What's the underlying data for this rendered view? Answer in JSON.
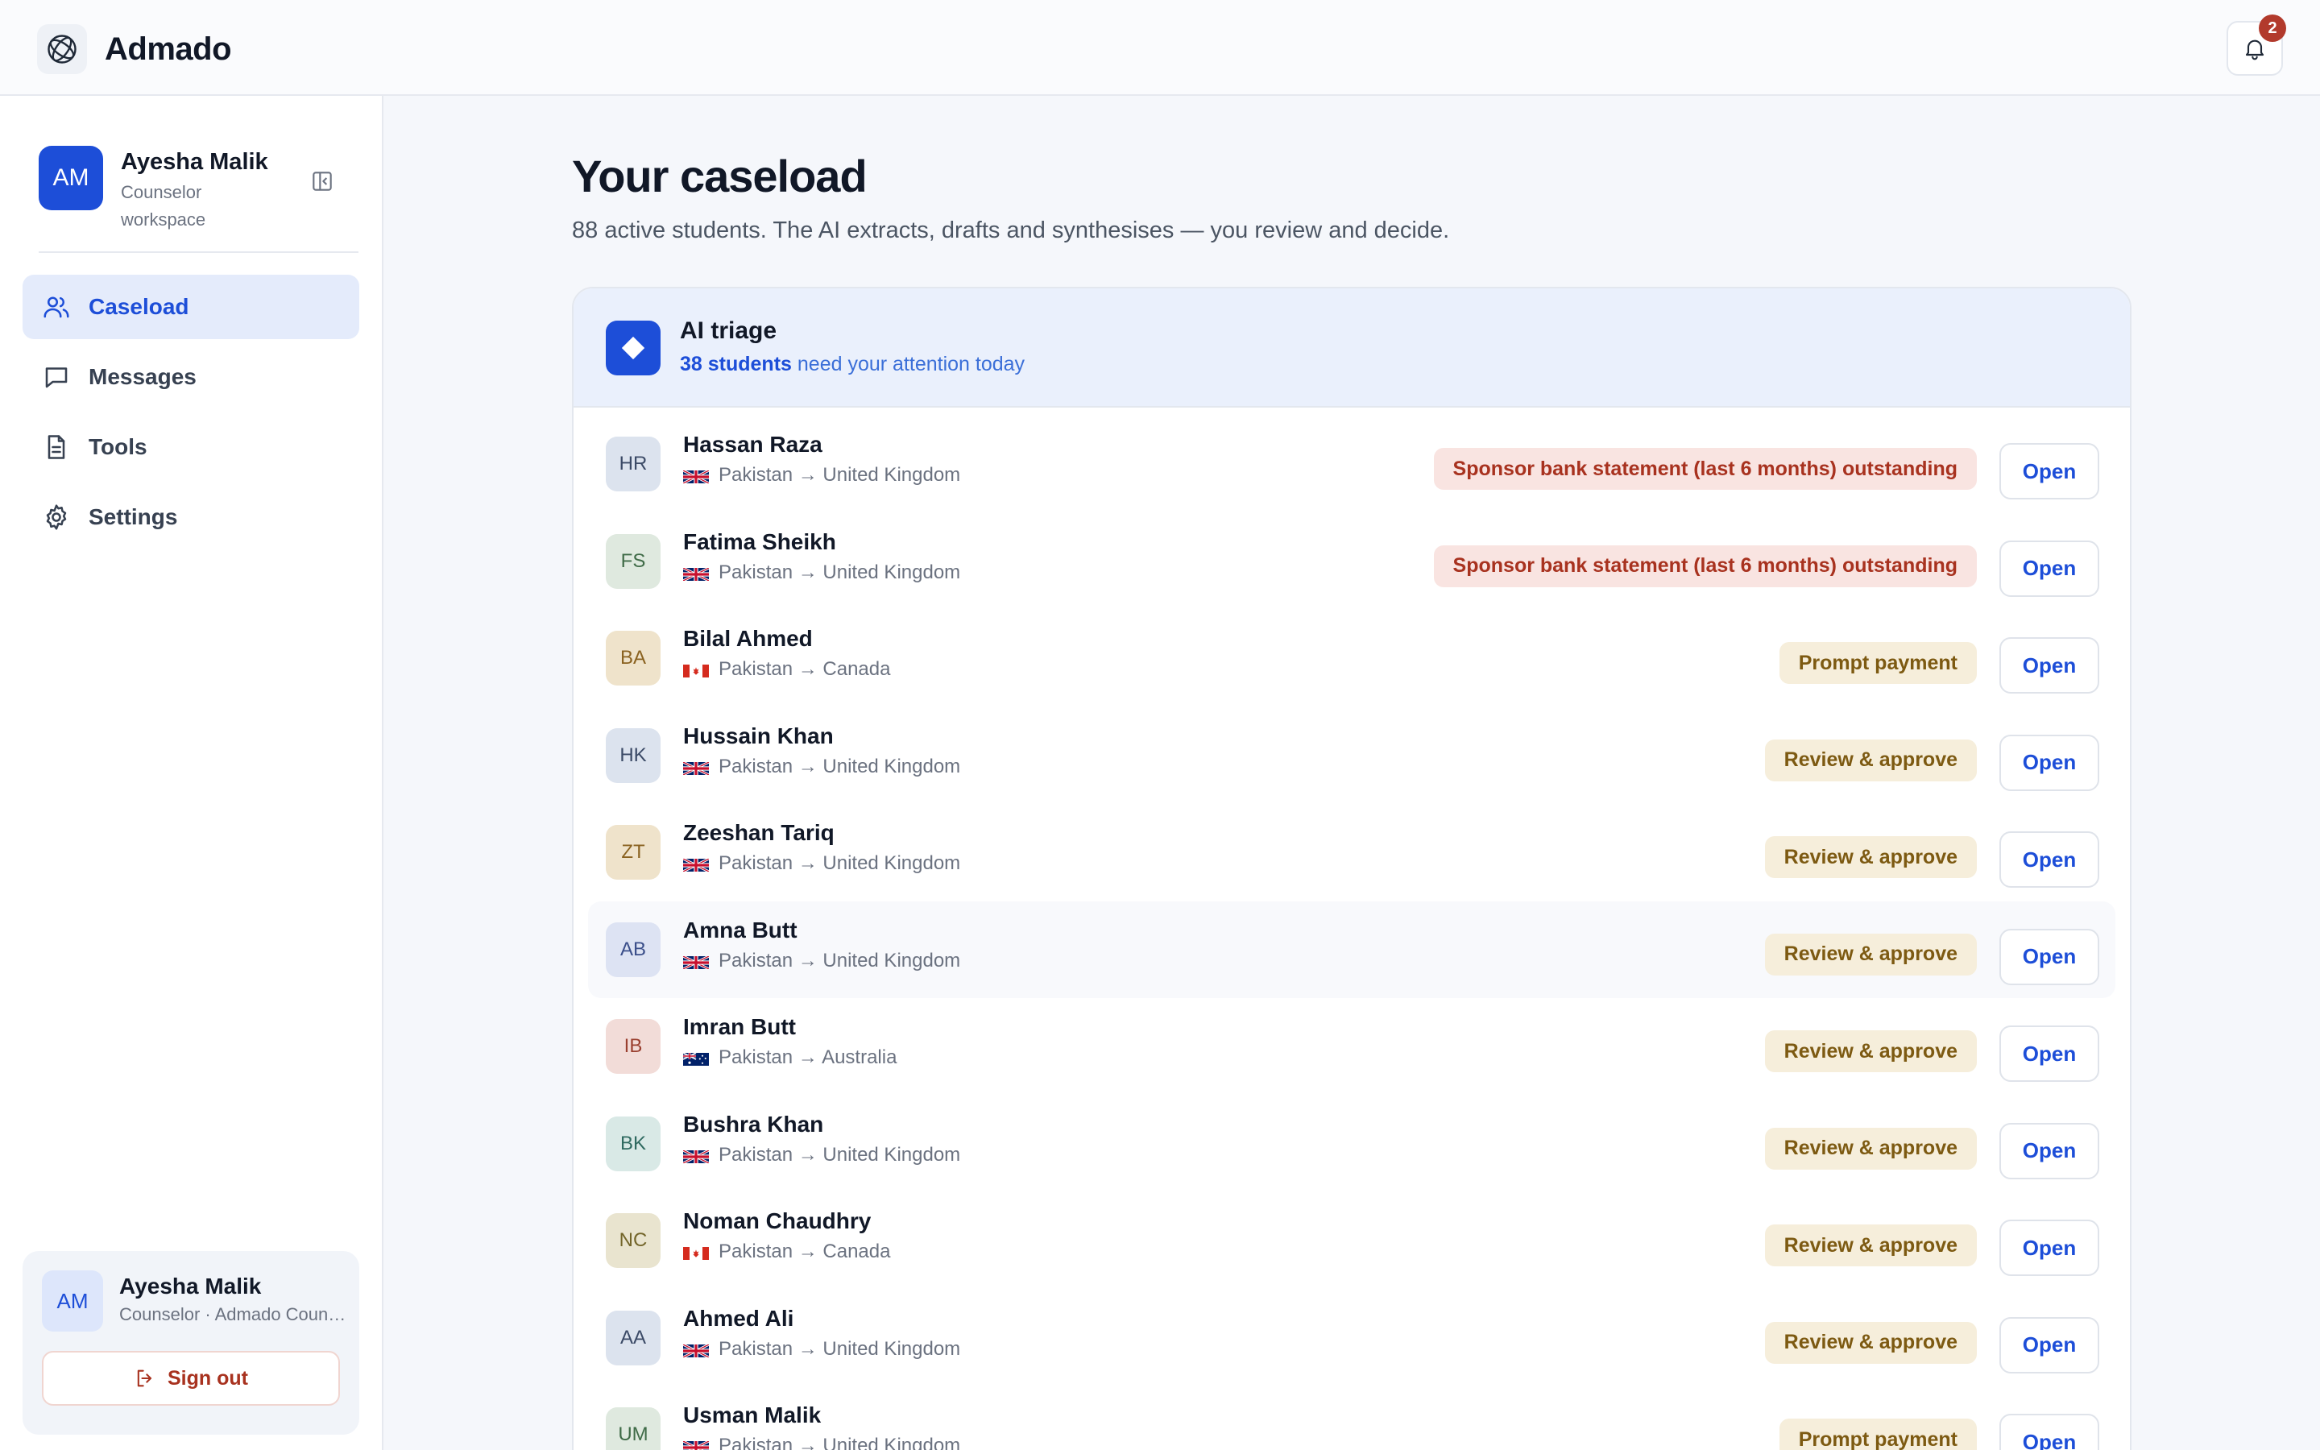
{
  "app": {
    "name": "Admado"
  },
  "notifications": {
    "count": "2",
    "icon": "bell-icon"
  },
  "sidebar": {
    "profile": {
      "initials": "AM",
      "name": "Ayesha Malik",
      "role": "Counselor workspace"
    },
    "nav": [
      {
        "label": "Caseload",
        "icon": "users-icon",
        "active": true
      },
      {
        "label": "Messages",
        "icon": "message-icon",
        "active": false
      },
      {
        "label": "Tools",
        "icon": "document-icon",
        "active": false
      },
      {
        "label": "Settings",
        "icon": "gear-icon",
        "active": false
      }
    ],
    "account": {
      "initials": "AM",
      "name": "Ayesha Malik",
      "role": "Counselor · Admado Counseling",
      "signout": "Sign out"
    }
  },
  "main": {
    "title": "Your caseload",
    "subtitle": "88 active students. The AI extracts, drafts and synthesises — you review and decide.",
    "triage": {
      "title": "AI triage",
      "count": "38 students",
      "rest": " need your attention today"
    },
    "open_label": "Open",
    "students": [
      {
        "initials": "HR",
        "name": "Hassan Raza",
        "route": "Pakistan → United Kingdom",
        "flag": "uk",
        "tag": "Sponsor bank statement (last 6 months) outstanding",
        "tone": "red",
        "avatar_bg": "#dce3ee",
        "avatar_fg": "#3b4a66"
      },
      {
        "initials": "FS",
        "name": "Fatima Sheikh",
        "route": "Pakistan → United Kingdom",
        "flag": "uk",
        "tag": "Sponsor bank statement (last 6 months) outstanding",
        "tone": "red",
        "avatar_bg": "#dfe9df",
        "avatar_fg": "#3f6b47"
      },
      {
        "initials": "BA",
        "name": "Bilal Ahmed",
        "route": "Pakistan → Canada",
        "flag": "ca",
        "tag": "Prompt payment",
        "tone": "amber",
        "avatar_bg": "#efe3cb",
        "avatar_fg": "#8a6220"
      },
      {
        "initials": "HK",
        "name": "Hussain Khan",
        "route": "Pakistan → United Kingdom",
        "flag": "uk",
        "tag": "Review & approve",
        "tone": "amber",
        "avatar_bg": "#dce3ee",
        "avatar_fg": "#3b4a66"
      },
      {
        "initials": "ZT",
        "name": "Zeeshan Tariq",
        "route": "Pakistan → United Kingdom",
        "flag": "uk",
        "tag": "Review & approve",
        "tone": "amber",
        "avatar_bg": "#efe3cb",
        "avatar_fg": "#8a6220"
      },
      {
        "initials": "AB",
        "name": "Amna Butt",
        "route": "Pakistan → United Kingdom",
        "flag": "uk",
        "tag": "Review & approve",
        "tone": "amber",
        "avatar_bg": "#dde3f3",
        "avatar_fg": "#3b4f8a"
      },
      {
        "initials": "IB",
        "name": "Imran Butt",
        "route": "Pakistan → Australia",
        "flag": "au",
        "tag": "Review & approve",
        "tone": "amber",
        "avatar_bg": "#f2dcd8",
        "avatar_fg": "#9a4030"
      },
      {
        "initials": "BK",
        "name": "Bushra Khan",
        "route": "Pakistan → United Kingdom",
        "flag": "uk",
        "tag": "Review & approve",
        "tone": "amber",
        "avatar_bg": "#d9e9e6",
        "avatar_fg": "#2f6a60"
      },
      {
        "initials": "NC",
        "name": "Noman Chaudhry",
        "route": "Pakistan → Canada",
        "flag": "ca",
        "tag": "Review & approve",
        "tone": "amber",
        "avatar_bg": "#e9e4cf",
        "avatar_fg": "#73652a"
      },
      {
        "initials": "AA",
        "name": "Ahmed Ali",
        "route": "Pakistan → United Kingdom",
        "flag": "uk",
        "tag": "Review & approve",
        "tone": "amber",
        "avatar_bg": "#dce3ee",
        "avatar_fg": "#3b4a66"
      },
      {
        "initials": "UM",
        "name": "Usman Malik",
        "route": "Pakistan → United Kingdom",
        "flag": "uk",
        "tag": "Prompt payment",
        "tone": "amber",
        "avatar_bg": "#dfe9df",
        "avatar_fg": "#3f6b47"
      }
    ]
  }
}
